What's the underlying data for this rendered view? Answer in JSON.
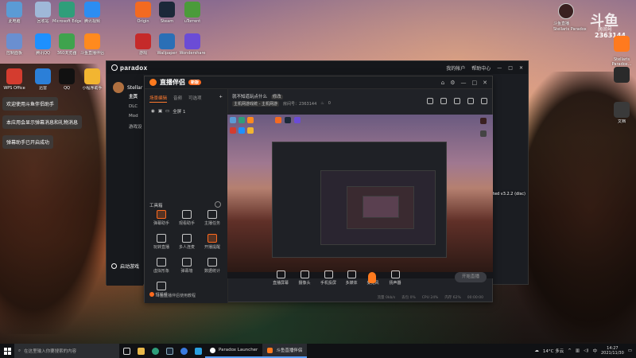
{
  "desktop": {
    "icons": [
      {
        "label": "此电脑",
        "color": "#5b9bd5"
      },
      {
        "label": "回收站",
        "color": "#9fb8d8"
      },
      {
        "label": "Microsoft Edge",
        "color": "#2f9e7a"
      },
      {
        "label": "腾讯视频",
        "color": "#2c8df2"
      },
      {
        "label": "控制面板",
        "color": "#6a8fd0"
      },
      {
        "label": "腾讯QQ",
        "color": "#1e90ff"
      },
      {
        "label": "360浏览器",
        "color": "#3fa34d"
      },
      {
        "label": "斗鱼直播伴侣",
        "color": "#ff8a1e"
      },
      {
        "label": "WPS Office",
        "color": "#d43c2f"
      },
      {
        "label": "迅雷",
        "color": "#2b7fd8"
      },
      {
        "label": "QQ",
        "color": "#111111"
      },
      {
        "label": "小程序助手",
        "color": "#f2b531"
      },
      {
        "label": "Origin",
        "color": "#f36a21"
      },
      {
        "label": "Steam",
        "color": "#1b2838"
      },
      {
        "label": "uTorrent",
        "color": "#4b9b3a"
      },
      {
        "label": "游戏",
        "color": "#c52a2a"
      },
      {
        "label": "Wallpaper",
        "color": "#2a6fb6"
      },
      {
        "label": "Wondershare",
        "color": "#6b4cd6"
      }
    ],
    "right_icons": [
      {
        "label": "斗鱼直播",
        "color": "#ff7a1e"
      },
      {
        "label": "Stellaris Paradox",
        "color": "#2a2a2a"
      },
      {
        "label": "文档",
        "color": "#3a3a3a"
      }
    ],
    "right_text_1": "Stellaris Paradox...",
    "right_text_2": "ted v3.2.2 (disc)"
  },
  "overlay": {
    "logo": "斗鱼",
    "room_label": "房间号",
    "room_id": "2363144"
  },
  "toasts": [
    "欢迎使用斗鱼伴侣助手",
    "本应用会显示弹幕消息和礼物消息",
    "弹幕助手已开启成功"
  ],
  "paradox": {
    "title": "paradox",
    "subtitle": "INTERACTIVE",
    "user": "Stellar",
    "links": [
      "我的帐户",
      "帮助中心"
    ],
    "menu": [
      "主页",
      "DLC",
      "Mod",
      "游戏设"
    ],
    "launch": "启动游戏"
  },
  "douyu": {
    "app_name": "直播伴侣",
    "badge": "新版",
    "scene_tabs": [
      "场景编辑",
      "音频",
      "可选项"
    ],
    "scene_item": "全屏 1",
    "room_title": "就不知道玩点什么",
    "edit_label": "修改",
    "category": "主机网游戏统 - 主机网游",
    "room_number_label": "房间号：2363144",
    "hot": "0",
    "tools_title": "工具箱",
    "tools": [
      {
        "label": "弹幕助手",
        "hot": true
      },
      {
        "label": "观看助手",
        "hot": false
      },
      {
        "label": "主播任务",
        "hot": false
      },
      {
        "label": "玩转直播",
        "hot": false
      },
      {
        "label": "多人连麦",
        "hot": false
      },
      {
        "label": "开播提醒",
        "hot": true
      },
      {
        "label": "虚拟形象",
        "hot": false
      },
      {
        "label": "弹幕墙",
        "hot": false
      },
      {
        "label": "数据统计",
        "hot": false
      },
      {
        "label": "短视频",
        "hot": false
      }
    ],
    "controls": [
      "直播屏幕",
      "摄像头",
      "手机投屏",
      "多媒体",
      "麦克风",
      "扬声器"
    ],
    "start_button": "开始直播",
    "status": [
      "流量 0kb/s",
      "丢包 0%",
      "CPU 24%",
      "内存 62%",
      "00:00:00"
    ],
    "help_link": "斗鱼直播伴侣使用教程"
  },
  "taskbar": {
    "search_placeholder": "在这里输入你要搜索的内容",
    "apps": [
      {
        "label": "Paradox Launcher",
        "active": false
      },
      {
        "label": "斗鱼直播伴侣",
        "active": true
      }
    ],
    "weather": "14°C 多云",
    "time": "14:27",
    "date": "2021/11/30"
  }
}
